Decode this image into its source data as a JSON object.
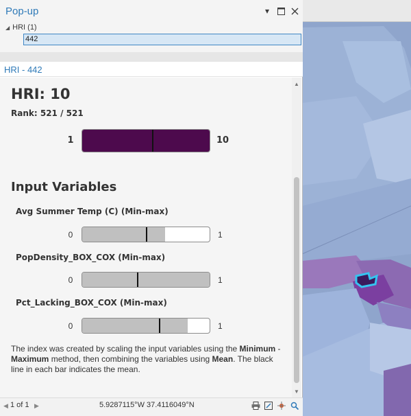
{
  "window": {
    "title": "Pop-up",
    "pin_icon": "pin-icon",
    "maximize_icon": "maximize-icon",
    "close_icon": "close-icon"
  },
  "tree": {
    "group_label": "HRI (1)",
    "selected_item": "442"
  },
  "record": {
    "title": "HRI - 442"
  },
  "popup": {
    "hri_title": "HRI: 10",
    "rank": "Rank: 521 / 521",
    "scale_min": "1",
    "scale_max": "10",
    "bar_color": "#4d0a4d",
    "marker_fraction": 0.55,
    "section_title": "Input Variables",
    "variables": [
      {
        "label": "Avg Summer Temp (C) (Min-max)",
        "min": "0",
        "max": "1",
        "fill_fraction": 0.65,
        "marker_fraction": 0.5
      },
      {
        "label": "PopDensity_BOX_COX (Min-max)",
        "min": "0",
        "max": "1",
        "fill_fraction": 1.0,
        "marker_fraction": 0.43
      },
      {
        "label": "Pct_Lacking_BOX_COX (Min-max)",
        "min": "0",
        "max": "1",
        "fill_fraction": 0.83,
        "marker_fraction": 0.6
      }
    ],
    "variable_fill_color": "#c0c0c0",
    "description": {
      "p1": "The index was created by scaling the input variables using the ",
      "b1": "Minimum",
      "p2": " - ",
      "b2": "Maximum",
      "p3": " method, then combining the variables using ",
      "b3": "Mean",
      "p4": ". The black line in each bar indicates the mean."
    }
  },
  "status": {
    "page": "1 of 1",
    "coordinates": "5.9287115°W 37.4116049°N",
    "tools": [
      "print-icon",
      "export-icon",
      "flash-icon",
      "zoom-to-icon"
    ]
  },
  "colors": {
    "accent": "#2f7ab8",
    "selection_bg": "#d7e7f5",
    "highlight_outline": "#35c4f0"
  }
}
